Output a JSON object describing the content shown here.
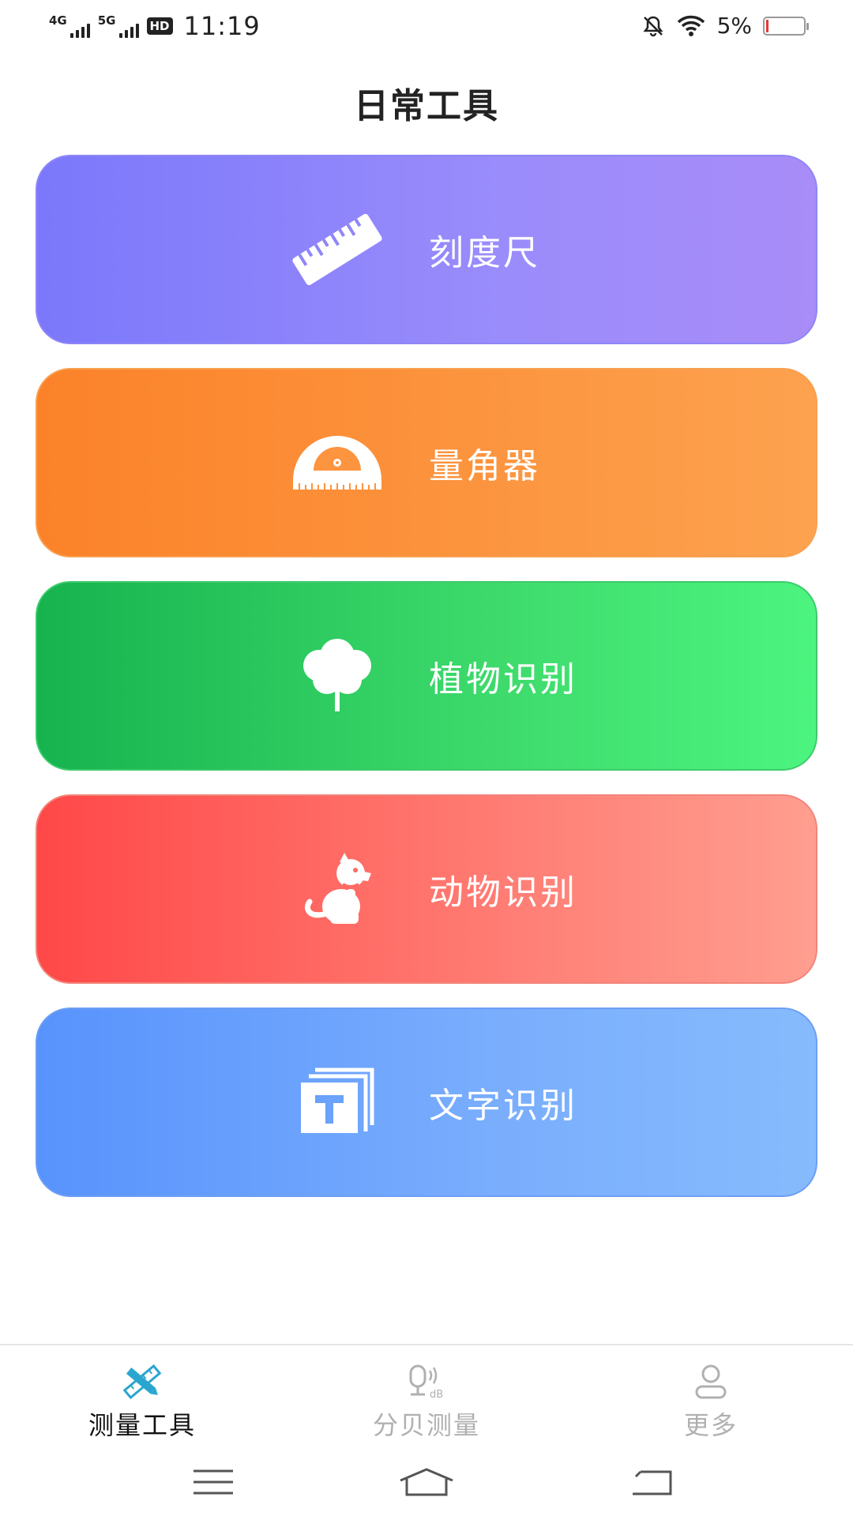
{
  "status_bar": {
    "network_1": "4G",
    "network_2": "5G",
    "hd_badge": "HD",
    "time": "11:19",
    "battery_text": "5%",
    "battery_level_percent": 5,
    "icons": [
      "mute-bell-icon",
      "wifi-icon",
      "battery-icon"
    ]
  },
  "page": {
    "title": "日常工具"
  },
  "tools": [
    {
      "label": "刻度尺",
      "icon": "ruler-icon"
    },
    {
      "label": "量角器",
      "icon": "protractor-icon"
    },
    {
      "label": "植物识别",
      "icon": "tree-icon"
    },
    {
      "label": "动物识别",
      "icon": "dog-icon"
    },
    {
      "label": "文字识别",
      "icon": "text-recognition-icon"
    }
  ],
  "tab_bar": {
    "active": "测量工具",
    "tabs": [
      {
        "label": "测量工具",
        "icon": "ruler-pencil-icon",
        "active_color": "#2aa6ce"
      },
      {
        "label": "分贝测量",
        "icon": "microphone-db-icon"
      },
      {
        "label": "更多",
        "icon": "person-icon"
      }
    ]
  },
  "nav_bar": {
    "buttons": [
      "menu-icon",
      "home-icon",
      "back-icon"
    ]
  }
}
